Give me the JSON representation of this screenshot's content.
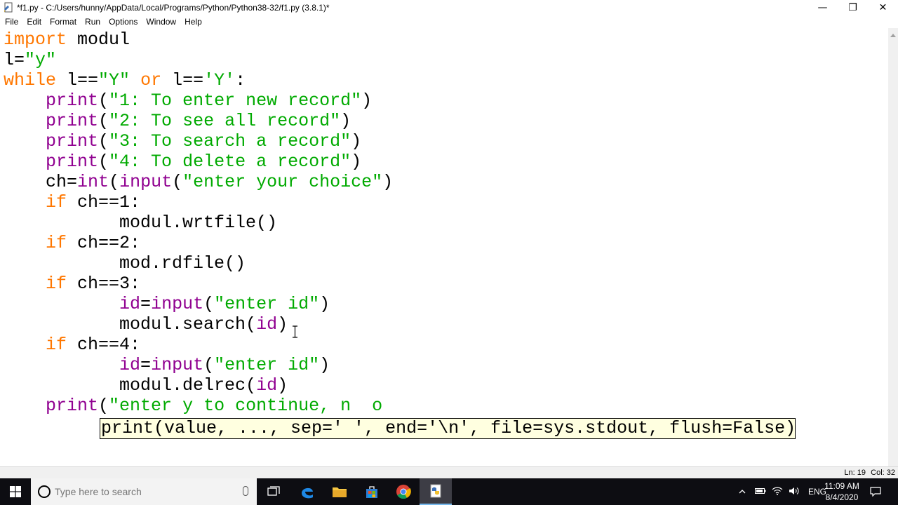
{
  "window": {
    "title": "*f1.py - C:/Users/hunny/AppData/Local/Programs/Python/Python38-32/f1.py (3.8.1)*",
    "minimize": "—",
    "maximize": "❐",
    "close": "✕"
  },
  "menu": [
    "File",
    "Edit",
    "Format",
    "Run",
    "Options",
    "Window",
    "Help"
  ],
  "code": [
    [
      {
        "t": "import",
        "c": "kw"
      },
      {
        "t": " modul",
        "c": ""
      }
    ],
    [
      {
        "t": "l=",
        "c": ""
      },
      {
        "t": "\"y\"",
        "c": "st"
      }
    ],
    [
      {
        "t": "while",
        "c": "kw"
      },
      {
        "t": " l==",
        "c": ""
      },
      {
        "t": "\"Y\"",
        "c": "st"
      },
      {
        "t": " ",
        "c": ""
      },
      {
        "t": "or",
        "c": "kw"
      },
      {
        "t": " l==",
        "c": ""
      },
      {
        "t": "'Y'",
        "c": "st"
      },
      {
        "t": ":",
        "c": ""
      }
    ],
    [
      {
        "t": "    ",
        "c": ""
      },
      {
        "t": "print",
        "c": "bi"
      },
      {
        "t": "(",
        "c": ""
      },
      {
        "t": "\"1: To enter new record\"",
        "c": "st"
      },
      {
        "t": ")",
        "c": ""
      }
    ],
    [
      {
        "t": "    ",
        "c": ""
      },
      {
        "t": "print",
        "c": "bi"
      },
      {
        "t": "(",
        "c": ""
      },
      {
        "t": "\"2: To see all record\"",
        "c": "st"
      },
      {
        "t": ")",
        "c": ""
      }
    ],
    [
      {
        "t": "    ",
        "c": ""
      },
      {
        "t": "print",
        "c": "bi"
      },
      {
        "t": "(",
        "c": ""
      },
      {
        "t": "\"3: To search a record\"",
        "c": "st"
      },
      {
        "t": ")",
        "c": ""
      }
    ],
    [
      {
        "t": "    ",
        "c": ""
      },
      {
        "t": "print",
        "c": "bi"
      },
      {
        "t": "(",
        "c": ""
      },
      {
        "t": "\"4: To delete a record\"",
        "c": "st"
      },
      {
        "t": ")",
        "c": ""
      }
    ],
    [
      {
        "t": "    ch=",
        "c": ""
      },
      {
        "t": "int",
        "c": "bi"
      },
      {
        "t": "(",
        "c": ""
      },
      {
        "t": "input",
        "c": "bi"
      },
      {
        "t": "(",
        "c": ""
      },
      {
        "t": "\"enter your choice\"",
        "c": "st"
      },
      {
        "t": ")",
        "c": ""
      }
    ],
    [
      {
        "t": "    ",
        "c": ""
      },
      {
        "t": "if",
        "c": "kw"
      },
      {
        "t": " ch==1:",
        "c": ""
      }
    ],
    [
      {
        "t": "           modul.wrtfile()",
        "c": ""
      }
    ],
    [
      {
        "t": "    ",
        "c": ""
      },
      {
        "t": "if",
        "c": "kw"
      },
      {
        "t": " ch==2:",
        "c": ""
      }
    ],
    [
      {
        "t": "           mod.rdfile()",
        "c": ""
      }
    ],
    [
      {
        "t": "    ",
        "c": ""
      },
      {
        "t": "if",
        "c": "kw"
      },
      {
        "t": " ch==3:",
        "c": ""
      }
    ],
    [
      {
        "t": "           ",
        "c": ""
      },
      {
        "t": "id",
        "c": "bi"
      },
      {
        "t": "=",
        "c": ""
      },
      {
        "t": "input",
        "c": "bi"
      },
      {
        "t": "(",
        "c": ""
      },
      {
        "t": "\"enter id\"",
        "c": "st"
      },
      {
        "t": ")",
        "c": ""
      }
    ],
    [
      {
        "t": "           modul.search(",
        "c": ""
      },
      {
        "t": "id",
        "c": "bi"
      },
      {
        "t": ")",
        "c": ""
      }
    ],
    [
      {
        "t": "    ",
        "c": ""
      },
      {
        "t": "if",
        "c": "kw"
      },
      {
        "t": " ch==4:",
        "c": ""
      }
    ],
    [
      {
        "t": "           ",
        "c": ""
      },
      {
        "t": "id",
        "c": "bi"
      },
      {
        "t": "=",
        "c": ""
      },
      {
        "t": "input",
        "c": "bi"
      },
      {
        "t": "(",
        "c": ""
      },
      {
        "t": "\"enter id\"",
        "c": "st"
      },
      {
        "t": ")",
        "c": ""
      }
    ],
    [
      {
        "t": "           modul.delrec(",
        "c": ""
      },
      {
        "t": "id",
        "c": "bi"
      },
      {
        "t": ")",
        "c": ""
      }
    ],
    [
      {
        "t": "    ",
        "c": ""
      },
      {
        "t": "print",
        "c": "bi"
      },
      {
        "t": "(",
        "c": ""
      },
      {
        "t": "\"enter y to continue, n  o",
        "c": "st"
      }
    ]
  ],
  "calltip": "print(value, ..., sep=' ', end='\\n', file=sys.stdout, flush=False)",
  "status": {
    "ln": "Ln: 19",
    "col": "Col: 32"
  },
  "taskbar": {
    "search_placeholder": "Type here to search",
    "lang": "ENG",
    "time": "11:09 AM",
    "date": "8/4/2020"
  },
  "colors": {
    "keyword": "#ff7700",
    "builtin": "#900090",
    "string": "#00aa00",
    "calltip_bg": "#ffffe0"
  }
}
